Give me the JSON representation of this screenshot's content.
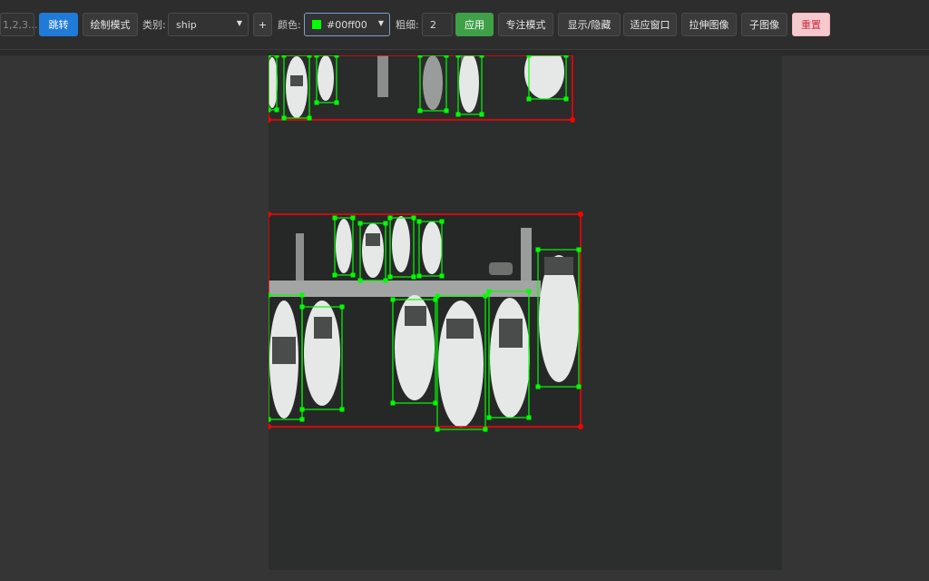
{
  "toolbar": {
    "index_input_placeholder": "1,2,3...",
    "jump_label": "跳转",
    "draw_mode_label": "绘制模式",
    "category_label": "类别:",
    "category_value": "ship",
    "add_label": "+",
    "color_label": "颜色:",
    "color_value": "#00ff00",
    "color_display": "#00ff00",
    "thickness_label": "粗细:",
    "thickness_value": "2",
    "apply_label": "应用",
    "focus_mode_label": "专注模式",
    "toggle_label": "显示/隐藏",
    "fit_window_label": "适应窗口",
    "stretch_label": "拉伸图像",
    "subimage_label": "子图像",
    "reset_label": "重置"
  },
  "colors": {
    "ship_box": "#00ff00",
    "region_box": "#ff0000"
  }
}
